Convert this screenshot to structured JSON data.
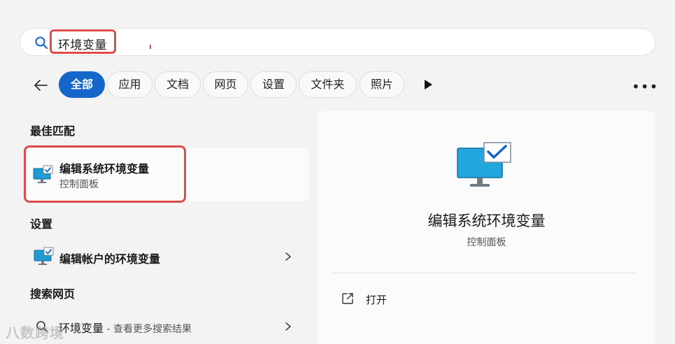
{
  "search": {
    "value": "环境变量",
    "highlight_color": "#e04a4a"
  },
  "filters": {
    "items": [
      {
        "label": "全部",
        "active": true
      },
      {
        "label": "应用",
        "active": false
      },
      {
        "label": "文档",
        "active": false
      },
      {
        "label": "网页",
        "active": false
      },
      {
        "label": "设置",
        "active": false
      },
      {
        "label": "文件夹",
        "active": false
      },
      {
        "label": "照片",
        "active": false
      }
    ],
    "more_label": "•••",
    "accent": "#1466c8"
  },
  "results": {
    "best_match_heading": "最佳匹配",
    "best_match": {
      "title": "编辑系统环境变量",
      "subtitle": "控制面板",
      "icon": "monitor-check-icon"
    },
    "settings_heading": "设置",
    "settings_item": {
      "title": "编辑帐户的环境变量",
      "icon": "monitor-check-icon"
    },
    "web_heading": "搜索网页",
    "web_item": {
      "query": "环境变量",
      "suffix": " - 查看更多搜索结果",
      "icon": "search-icon"
    }
  },
  "detail": {
    "title": "编辑系统环境变量",
    "subtitle": "控制面板",
    "open_label": "打开"
  },
  "watermark": {
    "text": "八数跨境"
  }
}
